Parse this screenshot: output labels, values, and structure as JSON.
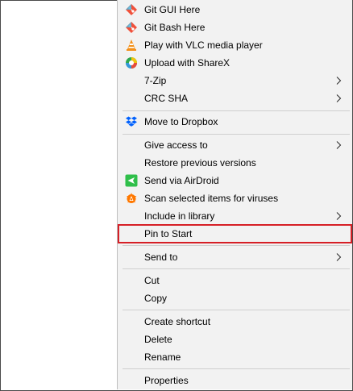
{
  "menu": {
    "items": [
      {
        "label": "Git GUI Here",
        "icon": "git-gui-icon"
      },
      {
        "label": "Git Bash Here",
        "icon": "git-bash-icon"
      },
      {
        "label": "Play with VLC media player",
        "icon": "vlc-icon"
      },
      {
        "label": "Upload with ShareX",
        "icon": "sharex-icon"
      },
      {
        "label": "7-Zip",
        "submenu": true
      },
      {
        "label": "CRC SHA",
        "submenu": true
      },
      {
        "label": "Move to Dropbox",
        "icon": "dropbox-icon"
      },
      {
        "label": "Give access to",
        "submenu": true
      },
      {
        "label": "Restore previous versions"
      },
      {
        "label": "Send via AirDroid",
        "icon": "airdroid-icon"
      },
      {
        "label": "Scan selected items for viruses",
        "icon": "avast-icon"
      },
      {
        "label": "Include in library",
        "submenu": true
      },
      {
        "label": "Pin to Start",
        "highlighted": true
      },
      {
        "label": "Send to",
        "submenu": true
      },
      {
        "label": "Cut"
      },
      {
        "label": "Copy"
      },
      {
        "label": "Create shortcut"
      },
      {
        "label": "Delete"
      },
      {
        "label": "Rename"
      },
      {
        "label": "Properties"
      }
    ],
    "highlight_color": "#d61f26",
    "background_color": "#f2f2f2"
  }
}
